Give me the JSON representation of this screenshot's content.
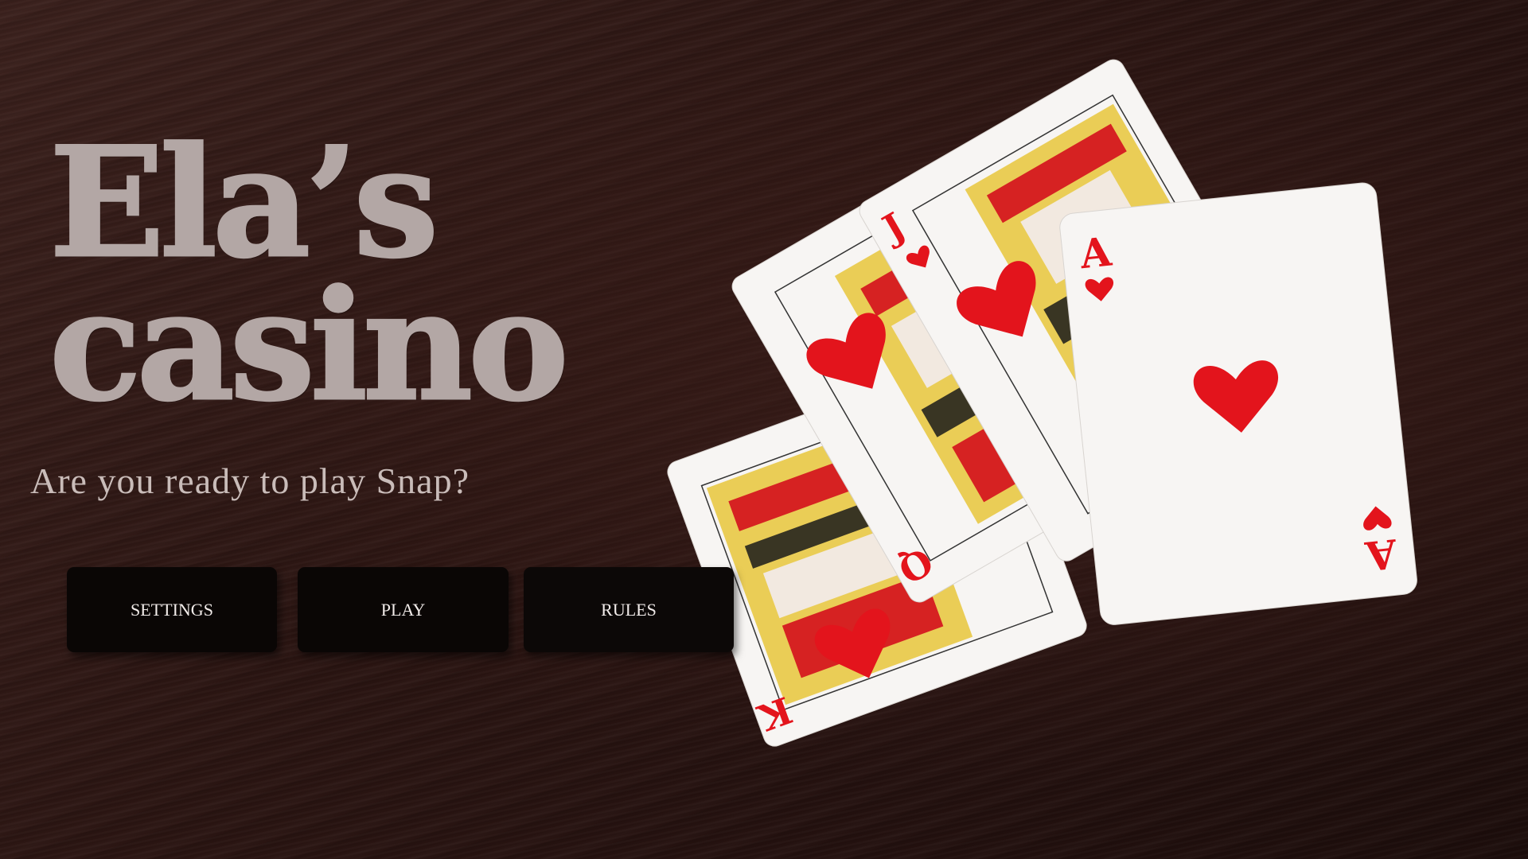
{
  "title": {
    "line1": "Ela’s",
    "line2": "casino"
  },
  "subtitle": "Are you ready to play Snap?",
  "buttons": {
    "settings": "SETTINGS",
    "play": "PLAY",
    "rules": "RULES"
  },
  "cards": {
    "king": {
      "rank": "K",
      "suit": "heart"
    },
    "queen": {
      "rank": "Q",
      "suit": "heart"
    },
    "jack": {
      "rank": "J",
      "suit": "heart"
    },
    "ace": {
      "rank": "A",
      "suit": "heart"
    }
  },
  "colors": {
    "title": "#b3a7a5",
    "subtitle": "#c9bcb9",
    "button_bg": "#0a0605",
    "button_text": "#f2ecea",
    "card_red": "#e3141c",
    "felt": "#2a1714"
  }
}
